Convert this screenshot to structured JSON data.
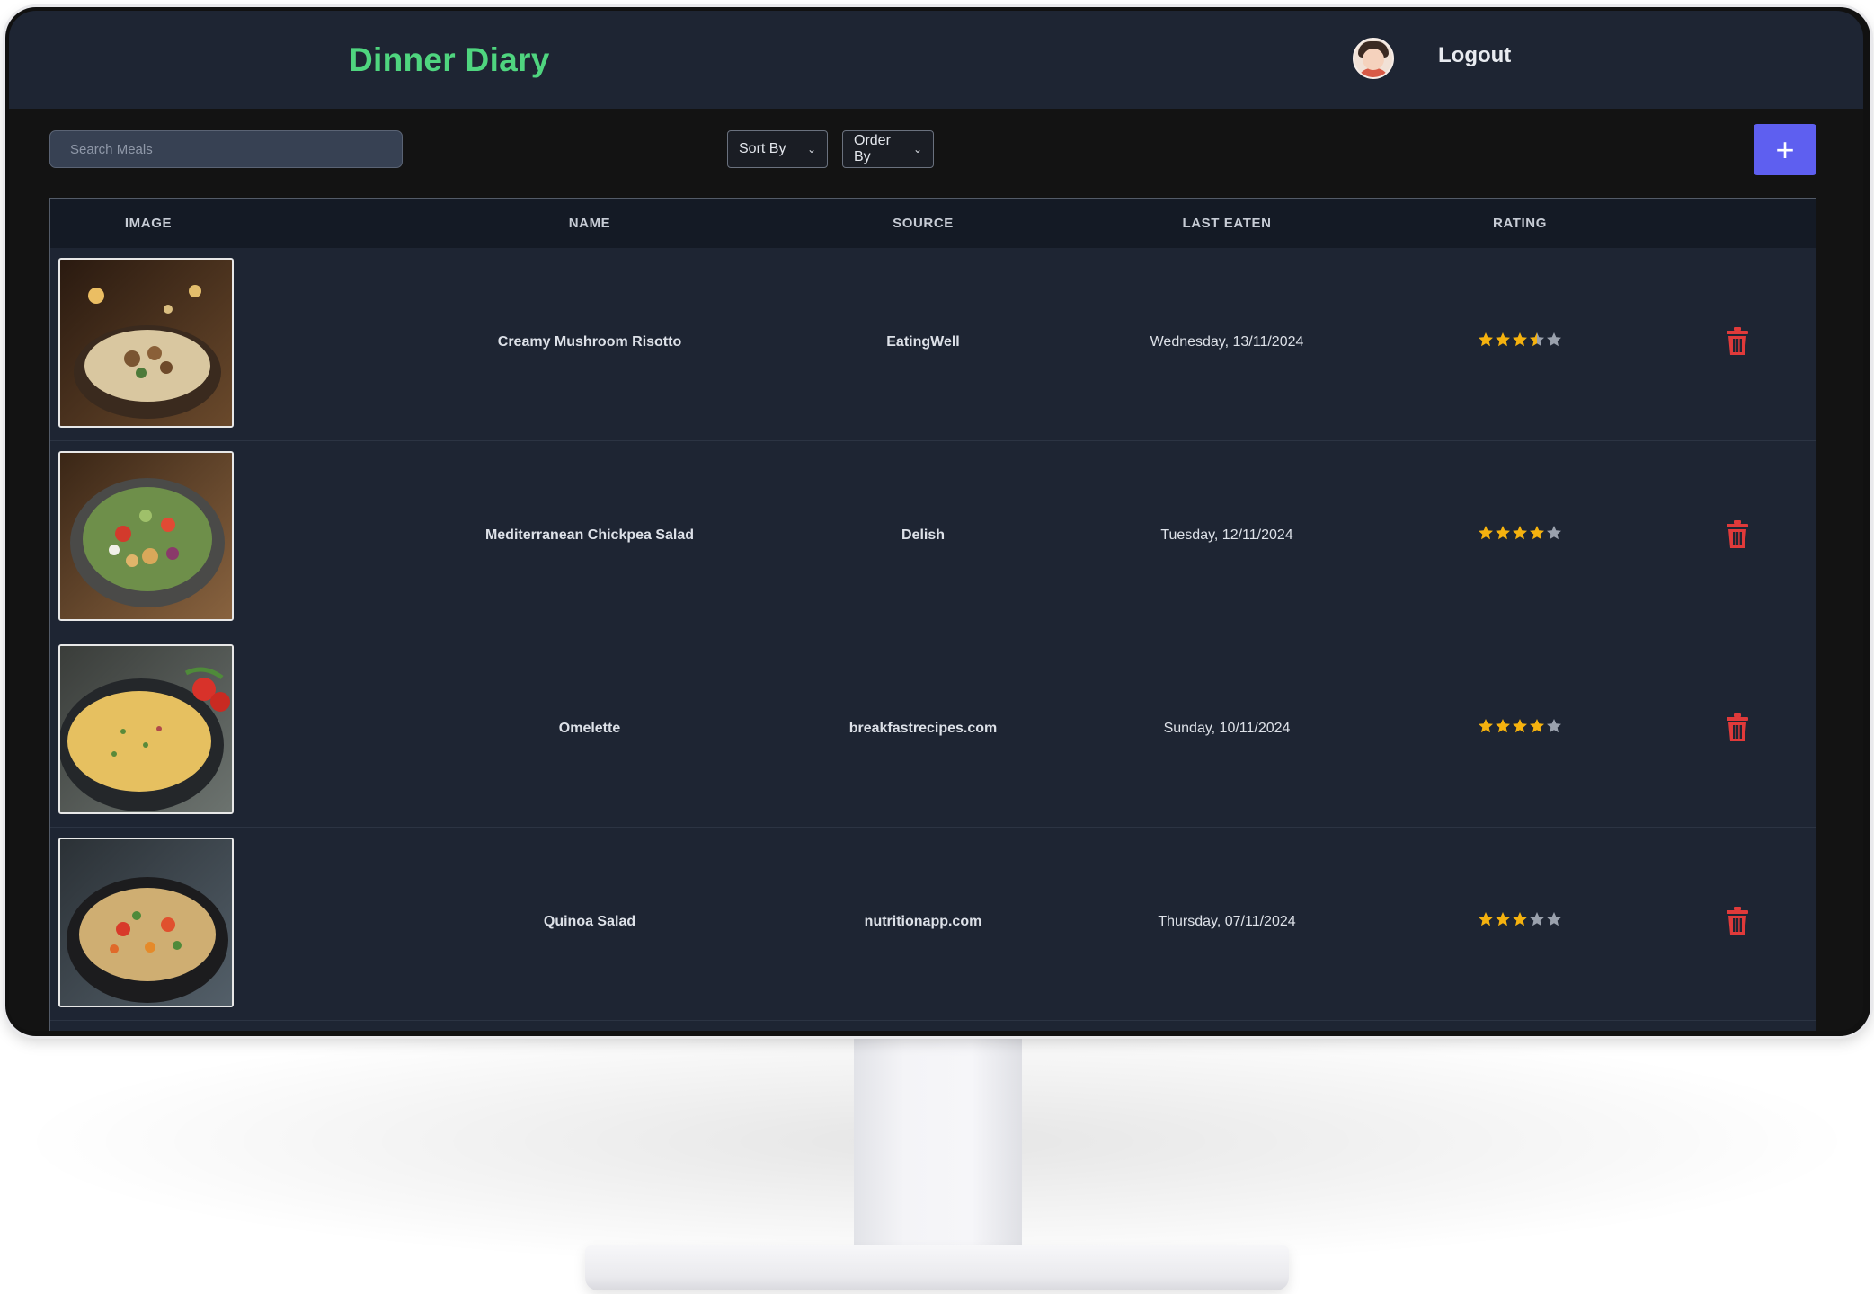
{
  "header": {
    "app_title": "Dinner Diary",
    "logout_label": "Logout"
  },
  "toolbar": {
    "search_placeholder": "Search Meals",
    "sort_label": "Sort By",
    "order_label": "Order By",
    "add_label": "+"
  },
  "table": {
    "columns": [
      "IMAGE",
      "NAME",
      "SOURCE",
      "LAST EATEN",
      "RATING",
      ""
    ],
    "rows": [
      {
        "name": "Creamy Mushroom Risotto",
        "source": "EatingWell",
        "last_eaten": "Wednesday, 13/11/2024",
        "rating": 3.5,
        "image": "risotto-photo"
      },
      {
        "name": "Mediterranean Chickpea Salad",
        "source": "Delish",
        "last_eaten": "Tuesday, 12/11/2024",
        "rating": 4,
        "image": "chickpea-salad-photo"
      },
      {
        "name": "Omelette",
        "source": "breakfastrecipes.com",
        "last_eaten": "Sunday, 10/11/2024",
        "rating": 4,
        "image": "omelette-photo"
      },
      {
        "name": "Quinoa Salad",
        "source": "nutritionapp.com",
        "last_eaten": "Thursday, 07/11/2024",
        "rating": 3,
        "image": "quinoa-salad-photo"
      }
    ]
  },
  "colors": {
    "accent": "#4fd57f",
    "add_button": "#5e5ff0",
    "star_filled": "#f5b20f",
    "star_empty": "#9aa1ad",
    "delete": "#e03a3a"
  }
}
